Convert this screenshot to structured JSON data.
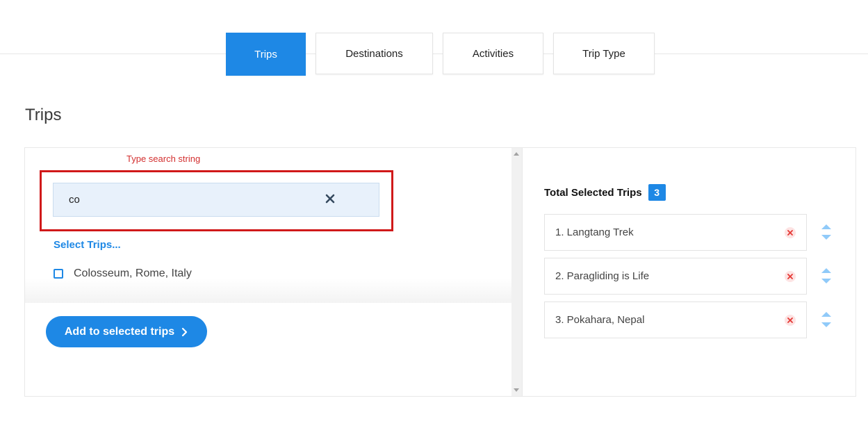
{
  "tabs": [
    {
      "label": "Trips",
      "active": true
    },
    {
      "label": "Destinations",
      "active": false
    },
    {
      "label": "Activities",
      "active": false
    },
    {
      "label": "Trip Type",
      "active": false
    }
  ],
  "page_title": "Trips",
  "annotation": "Type search string",
  "search": {
    "value": "co",
    "clear_icon": "close-icon"
  },
  "select_label": "Select Trips...",
  "options": [
    {
      "label": "Colosseum, Rome, Italy",
      "checked": false
    }
  ],
  "add_button": {
    "label": "Add to selected trips",
    "icon": "chevron-right-icon"
  },
  "selected": {
    "title": "Total Selected Trips",
    "count": "3",
    "items": [
      {
        "label": "1. Langtang Trek"
      },
      {
        "label": "2. Paragliding is Life"
      },
      {
        "label": "3. Pokahara, Nepal"
      }
    ]
  },
  "colors": {
    "accent": "#1e88e5",
    "annotation": "#d32f2f",
    "remove": "#e53935"
  }
}
